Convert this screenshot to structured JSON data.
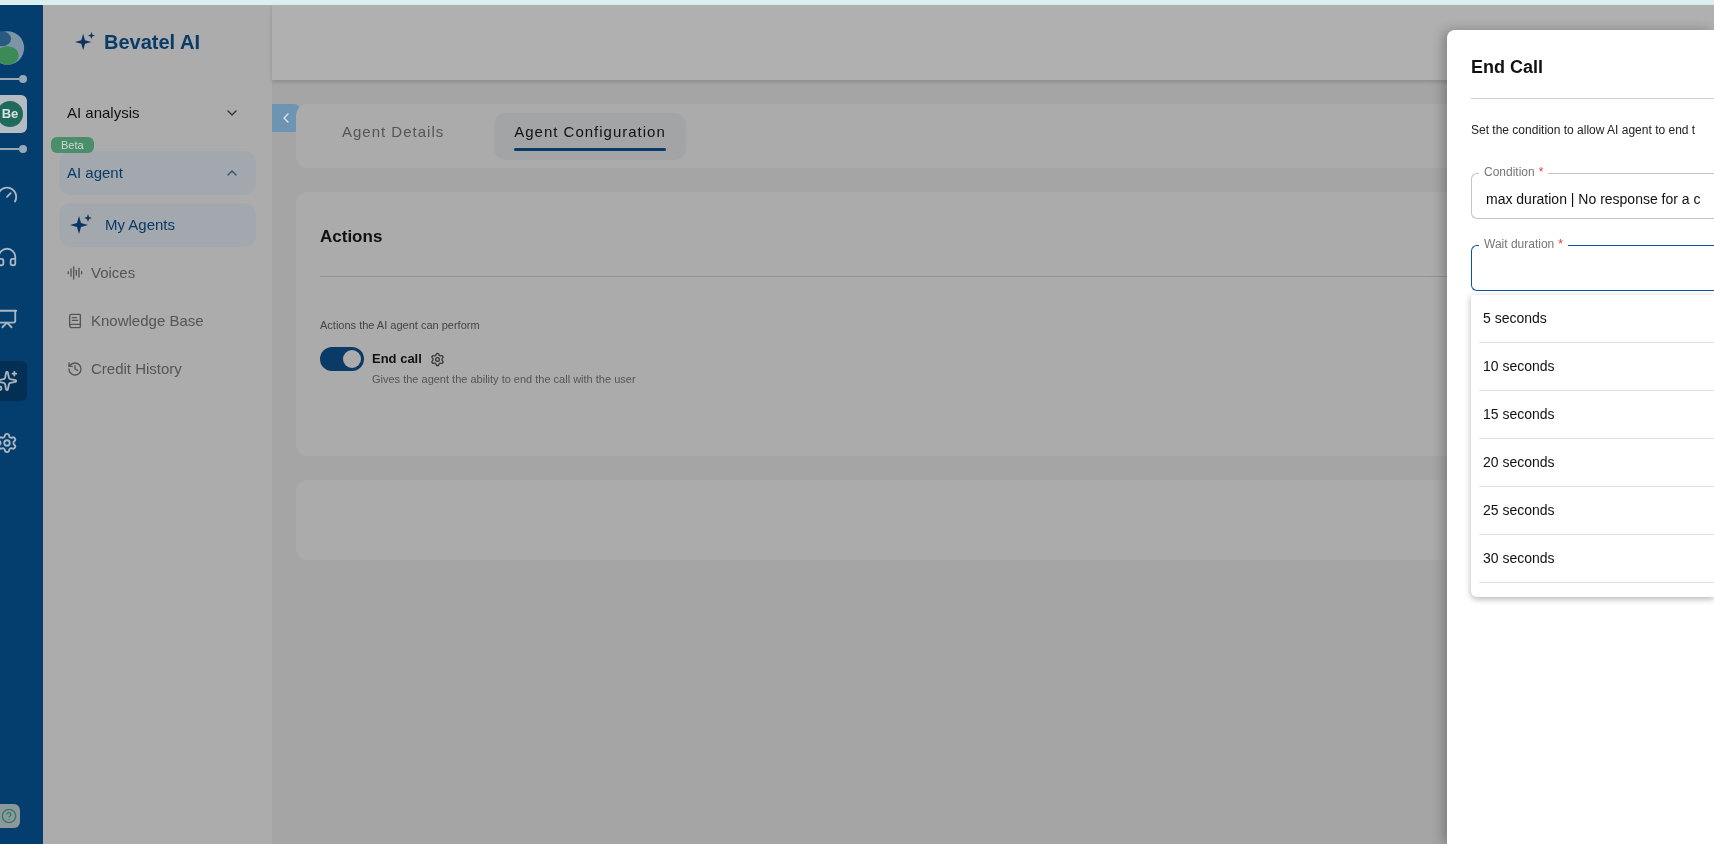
{
  "brand": {
    "name": "Bevatel AI"
  },
  "rail": {
    "avatar": "Be",
    "items": [
      {
        "kind": "gauge",
        "selected": false
      },
      {
        "kind": "headset",
        "selected": false
      },
      {
        "kind": "presentation",
        "selected": false
      },
      {
        "kind": "sparkle",
        "selected": true
      },
      {
        "kind": "settings",
        "selected": false
      }
    ]
  },
  "sidebar": {
    "groups": [
      {
        "label": "AI analysis",
        "expanded": false
      },
      {
        "label": "AI agent",
        "expanded": true,
        "badge": "Beta",
        "children": [
          {
            "label": "My Agents",
            "kind": "sparkle",
            "selected": true
          },
          {
            "label": "Voices",
            "kind": "voice",
            "selected": false
          },
          {
            "label": "Knowledge Base",
            "kind": "book",
            "selected": false
          },
          {
            "label": "Credit History",
            "kind": "history",
            "selected": false
          }
        ]
      }
    ]
  },
  "tabs": [
    {
      "label": "Agent Details",
      "selected": false
    },
    {
      "label": "Agent Configuration",
      "selected": true
    }
  ],
  "actions": {
    "title": "Actions",
    "subtitle": "Actions the AI agent can perform",
    "items": [
      {
        "label": "End call",
        "description": "Gives the agent the ability to end the call with the user",
        "on": true
      }
    ]
  },
  "drawer": {
    "title": "End Call",
    "description": "Set the condition to allow AI agent to end t",
    "fields": [
      {
        "label": "Condition",
        "required_mark": "*",
        "value": "max duration | No response for a c",
        "focused": false
      },
      {
        "label": "Wait duration",
        "required_mark": "*",
        "focused": true
      }
    ],
    "options": [
      "5 seconds",
      "10 seconds",
      "15 seconds",
      "20 seconds",
      "25 seconds",
      "30 seconds"
    ]
  }
}
